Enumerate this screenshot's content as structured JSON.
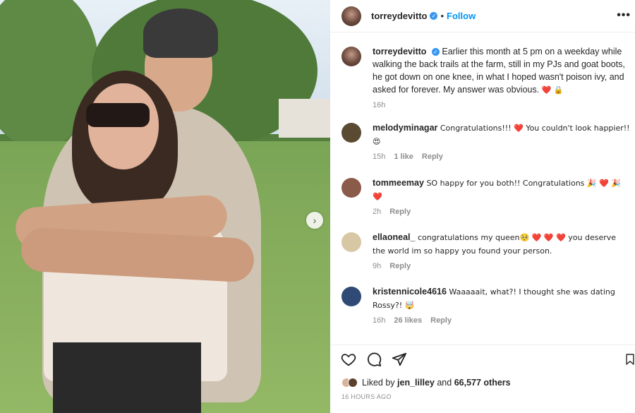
{
  "post_header": {
    "username": "torreydevitto",
    "separator": "•",
    "follow_label": "Follow",
    "more_label": "•••"
  },
  "caption": {
    "username": "torreydevitto",
    "text": "Earlier this month at 5 pm on a weekday while walking the back trails at the farm, still in my PJs and goat boots, he got down on one knee, in what I hoped wasn't poison ivy, and asked for forever. My answer was obvious.",
    "emoji": "❤️ 🔒",
    "time": "16h"
  },
  "comments": [
    {
      "username": "melodyminagar",
      "text": "Congratulations!!! ❤️ You couldn't look happier!! 😍",
      "time": "15h",
      "likes": "1 like",
      "reply_label": "Reply",
      "avatar_color": "#5a4a32"
    },
    {
      "username": "tommeemay",
      "text": "SO happy for you both!! Congratulations 🎉 ❤️ 🎉 ❤️",
      "time": "2h",
      "likes": "",
      "reply_label": "Reply",
      "avatar_color": "#8a5a4a"
    },
    {
      "username": "ellaoneal_",
      "text": "congratulations my queen🥺 ❤️ ❤️ ❤️ you deserve the world im so happy you found your person.",
      "time": "9h",
      "likes": "",
      "reply_label": "Reply",
      "avatar_color": "#d8c7a4"
    },
    {
      "username": "kristennicole4616",
      "text": "Waaaaait, what?! I thought she was dating Rossy?! 🤯",
      "time": "16h",
      "likes": "26 likes",
      "reply_label": "Reply",
      "avatar_color": "#2f4a74"
    }
  ],
  "liked_by": {
    "prefix": "Liked by",
    "user": "jen_lilley",
    "connector": "and",
    "others": "66,577 others"
  },
  "post_time": "16 HOURS AGO",
  "colors": {
    "accent": "#0095f6",
    "verified": "#3897f0",
    "heart": "#ed4956",
    "muted_text": "#8e8e8e"
  },
  "icons": {
    "like": "heart-icon",
    "comment": "comment-icon",
    "share": "send-icon",
    "save": "bookmark-icon",
    "carousel_next": "chevron-right-icon"
  }
}
